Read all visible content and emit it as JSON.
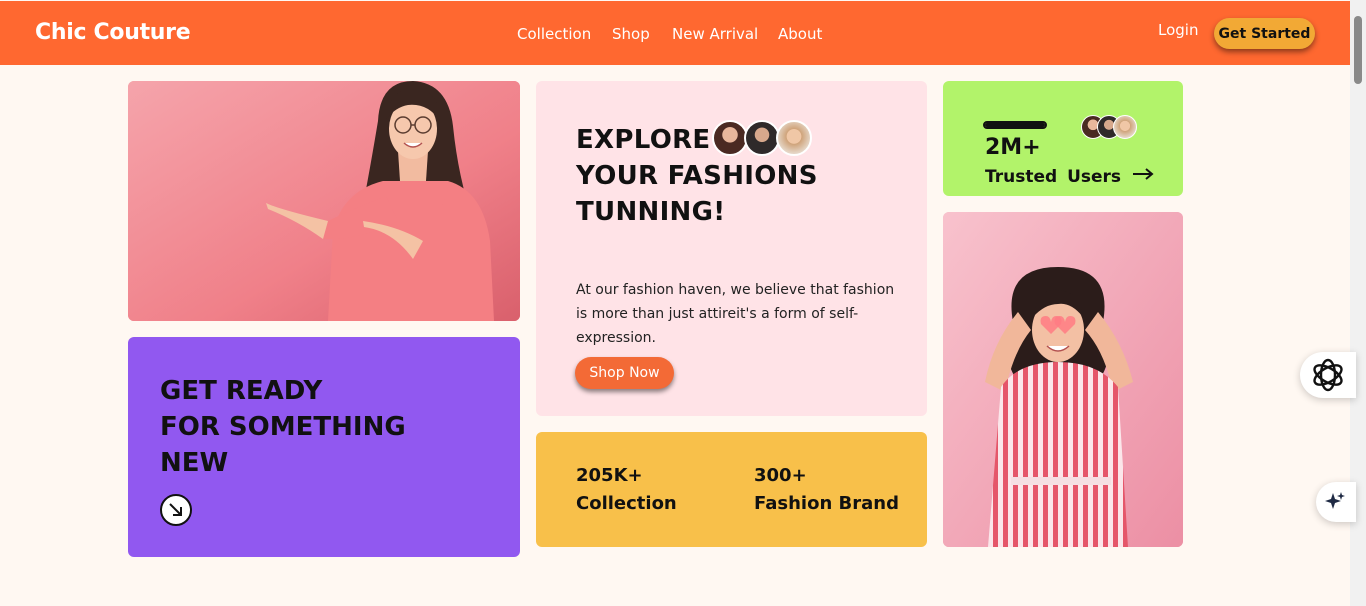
{
  "header": {
    "brand": "Chic Couture",
    "nav": [
      "Collection",
      "Shop",
      "New Arrival",
      "About"
    ],
    "login_label": "Login",
    "cta_label": "Get Started"
  },
  "promo": {
    "title_lines": [
      "GET READY",
      "FOR SOMETHING",
      "NEW"
    ]
  },
  "hero": {
    "title_lines": [
      "EXPLORE",
      "YOUR FASHIONS",
      "TUNNING!"
    ],
    "description": "At our fashion haven, we believe that fashion is more than just attireit's a form of self-expression.",
    "button_label": "Shop Now"
  },
  "stats": [
    {
      "value": "205K+",
      "label": "Collection"
    },
    {
      "value": "300+",
      "label": "Fashion Brand"
    }
  ],
  "users": {
    "count": "2M+",
    "label": "Trusted Users",
    "progress": 1.0
  },
  "colors": {
    "nav_bg": "#ff6830",
    "page_bg": "#fff8f2",
    "purple": "#9158f0",
    "pink": "#ffe3e7",
    "yellow": "#f8c04a",
    "green": "#b2f36a",
    "cta": "#f2a935",
    "shop_now": "#f36a36"
  },
  "icons": {
    "arrow_down_right": "arrow-down-right-icon",
    "arrow_right": "arrow-right-icon",
    "assistant": "openai-knot-icon",
    "sparkle": "sparkle-icon"
  }
}
